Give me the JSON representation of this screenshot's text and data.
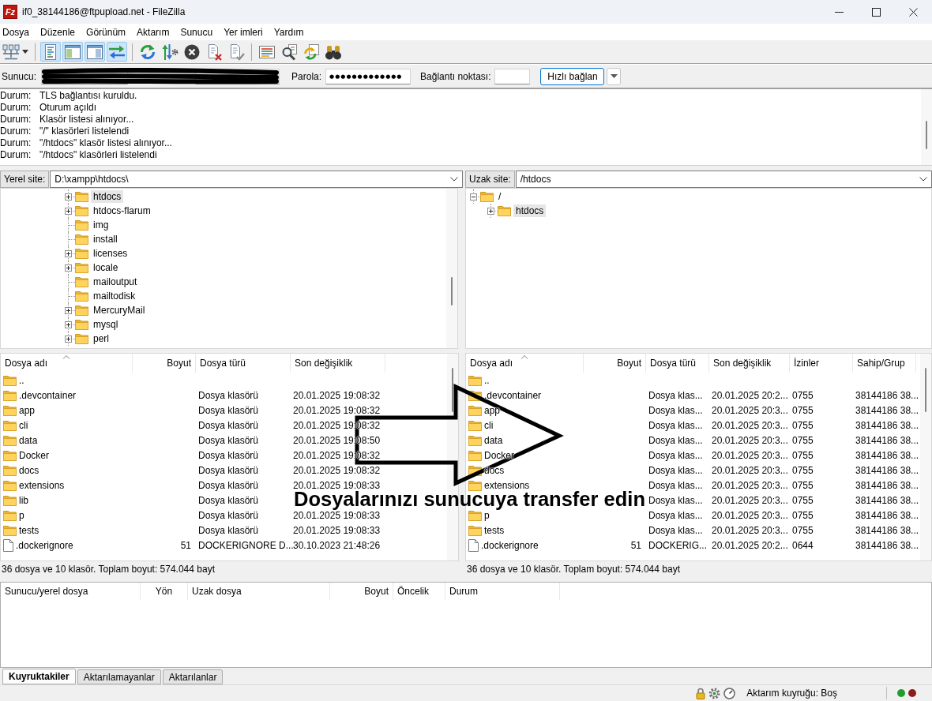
{
  "window": {
    "logo": "Fz",
    "title": "if0_38144186@ftpupload.net - FileZilla"
  },
  "menu": [
    "Dosya",
    "Düzenle",
    "Görünüm",
    "Aktarım",
    "Sunucu",
    "Yer imleri",
    "Yardım"
  ],
  "toolbar": {
    "groups": [
      [
        {
          "kind": "sitemanager"
        }
      ],
      [
        {
          "kind": "log",
          "on": true
        },
        {
          "kind": "localtree",
          "on": true
        },
        {
          "kind": "remotetree",
          "on": true
        },
        {
          "kind": "queue",
          "on": true
        }
      ],
      [
        {
          "kind": "refresh"
        },
        {
          "kind": "process"
        },
        {
          "kind": "cancel"
        },
        {
          "kind": "disconnect"
        },
        {
          "kind": "reconnect"
        }
      ],
      [
        {
          "kind": "filter"
        },
        {
          "kind": "compare"
        },
        {
          "kind": "sync"
        },
        {
          "kind": "search"
        }
      ]
    ]
  },
  "quickconnect": {
    "host_label": "Sunucu:",
    "password_label": "Parola:",
    "password": "●●●●●●●●●●●●●",
    "port_label": "Bağlantı noktası:",
    "connect_button": "Hızlı bağlan"
  },
  "message_log": [
    {
      "label": "Durum:",
      "text": "TLS bağlantısı kuruldu."
    },
    {
      "label": "Durum:",
      "text": "Oturum açıldı"
    },
    {
      "label": "Durum:",
      "text": "Klasör listesi alınıyor..."
    },
    {
      "label": "Durum:",
      "text": "\"/\" klasörleri listelendi"
    },
    {
      "label": "Durum:",
      "text": "\"/htdocs\" klasör listesi alınıyor..."
    },
    {
      "label": "Durum:",
      "text": "\"/htdocs\" klasörleri listelendi"
    }
  ],
  "local": {
    "site_label": "Yerel site:",
    "path": "D:\\xampp\\htdocs\\",
    "tree": [
      {
        "name": "htdocs",
        "expandable": true,
        "expanded": false,
        "selected": true
      },
      {
        "name": "htdocs-flarum",
        "expandable": true,
        "expanded": false,
        "selected": false
      },
      {
        "name": "img",
        "expandable": false,
        "expanded": false,
        "selected": false
      },
      {
        "name": "install",
        "expandable": false,
        "expanded": false,
        "selected": false
      },
      {
        "name": "licenses",
        "expandable": true,
        "expanded": false,
        "selected": false
      },
      {
        "name": "locale",
        "expandable": true,
        "expanded": false,
        "selected": false
      },
      {
        "name": "mailoutput",
        "expandable": false,
        "expanded": false,
        "selected": false
      },
      {
        "name": "mailtodisk",
        "expandable": false,
        "expanded": false,
        "selected": false
      },
      {
        "name": "MercuryMail",
        "expandable": true,
        "expanded": false,
        "selected": false
      },
      {
        "name": "mysql",
        "expandable": true,
        "expanded": false,
        "selected": false
      },
      {
        "name": "perl",
        "expandable": true,
        "expanded": false,
        "selected": false
      }
    ],
    "columns": [
      {
        "label": "Dosya adı",
        "sorted": true
      },
      {
        "label": "Boyut",
        "sorted": false
      },
      {
        "label": "Dosya türü",
        "sorted": false
      },
      {
        "label": "Son değişiklik",
        "sorted": false
      }
    ],
    "rows": [
      {
        "kind": "folder",
        "name": ".."
      },
      {
        "kind": "folder",
        "name": ".devcontainer",
        "type": "Dosya klasörü",
        "modified": "20.01.2025 19:08:32"
      },
      {
        "kind": "folder",
        "name": "app",
        "type": "Dosya klasörü",
        "modified": "20.01.2025 19:08:32"
      },
      {
        "kind": "folder",
        "name": "cli",
        "type": "Dosya klasörü",
        "modified": "20.01.2025 19:08:32"
      },
      {
        "kind": "folder",
        "name": "data",
        "type": "Dosya klasörü",
        "modified": "20.01.2025 19:08:50"
      },
      {
        "kind": "folder",
        "name": "Docker",
        "type": "Dosya klasörü",
        "modified": "20.01.2025 19:08:32"
      },
      {
        "kind": "folder",
        "name": "docs",
        "type": "Dosya klasörü",
        "modified": "20.01.2025 19:08:32"
      },
      {
        "kind": "folder",
        "name": "extensions",
        "type": "Dosya klasörü",
        "modified": "20.01.2025 19:08:33"
      },
      {
        "kind": "folder",
        "name": "lib",
        "type": "Dosya klasörü"
      },
      {
        "kind": "folder",
        "name": "p",
        "type": "Dosya klasörü",
        "modified": "20.01.2025 19:08:33"
      },
      {
        "kind": "folder",
        "name": "tests",
        "type": "Dosya klasörü",
        "modified": "20.01.2025 19:08:33"
      },
      {
        "kind": "file",
        "name": ".dockerignore",
        "size": "51",
        "type": "DOCKERIGNORE D...",
        "modified": "30.10.2023 21:48:26"
      }
    ],
    "summary": "36 dosya ve 10 klasör. Toplam boyut: 574.044 bayt"
  },
  "remote": {
    "site_label": "Uzak site:",
    "path": "/htdocs",
    "tree": [
      {
        "name": "/",
        "expandable": true,
        "expanded": true,
        "selected": false,
        "children": [
          {
            "name": "htdocs",
            "expandable": true,
            "expanded": false,
            "selected": true
          }
        ]
      }
    ],
    "columns": [
      {
        "label": "Dosya adı",
        "sorted": true
      },
      {
        "label": "Boyut",
        "sorted": false
      },
      {
        "label": "Dosya türü",
        "sorted": false
      },
      {
        "label": "Son değişiklik",
        "sorted": false
      },
      {
        "label": "İzinler",
        "sorted": false
      },
      {
        "label": "Sahip/Grup",
        "sorted": false
      }
    ],
    "rows": [
      {
        "kind": "folder",
        "name": ".."
      },
      {
        "kind": "folder",
        "name": ".devcontainer",
        "type": "Dosya klas...",
        "modified": "20.01.2025 20:2...",
        "permissions": "0755",
        "owner": "38144186 38..."
      },
      {
        "kind": "folder",
        "name": "app",
        "type": "Dosya klas...",
        "modified": "20.01.2025 20:3...",
        "permissions": "0755",
        "owner": "38144186 38..."
      },
      {
        "kind": "folder",
        "name": "cli",
        "type": "Dosya klas...",
        "modified": "20.01.2025 20:3...",
        "permissions": "0755",
        "owner": "38144186 38..."
      },
      {
        "kind": "folder",
        "name": "data",
        "type": "Dosya klas...",
        "modified": "20.01.2025 20:3...",
        "permissions": "0755",
        "owner": "38144186 38..."
      },
      {
        "kind": "folder",
        "name": "Docker",
        "type": "Dosya klas...",
        "modified": "20.01.2025 20:3...",
        "permissions": "0755",
        "owner": "38144186 38..."
      },
      {
        "kind": "folder",
        "name": "docs",
        "type": "Dosya klas...",
        "modified": "20.01.2025 20:3...",
        "permissions": "0755",
        "owner": "38144186 38..."
      },
      {
        "kind": "folder",
        "name": "extensions",
        "type": "Dosya klas...",
        "modified": "20.01.2025 20:3...",
        "permissions": "0755",
        "owner": "38144186 38..."
      },
      {
        "type": "Dosya klas...",
        "modified": "20.01.2025 20:3...",
        "permissions": "0755",
        "owner": "38144186 38..."
      },
      {
        "kind": "folder",
        "name": "p",
        "type": "Dosya klas...",
        "modified": "20.01.2025 20:3...",
        "permissions": "0755",
        "owner": "38144186 38..."
      },
      {
        "kind": "folder",
        "name": "tests",
        "type": "Dosya klas...",
        "modified": "20.01.2025 20:3...",
        "permissions": "0755",
        "owner": "38144186 38..."
      },
      {
        "kind": "file",
        "name": ".dockerignore",
        "size": "51",
        "type": "DOCKERIG...",
        "modified": "20.01.2025 20:2...",
        "permissions": "0644",
        "owner": "38144186 38..."
      }
    ],
    "summary": "36 dosya ve 10 klasör. Toplam boyut: 574.044 bayt"
  },
  "queue": {
    "columns": [
      "Sunucu/yerel dosya",
      "Yön",
      "Uzak dosya",
      "Boyut",
      "Öncelik",
      "Durum"
    ],
    "tabs": [
      {
        "label": "Kuyruktakiler",
        "selected": true
      },
      {
        "label": "Aktarılamayanlar",
        "selected": false
      },
      {
        "label": "Aktarılanlar",
        "selected": false
      }
    ]
  },
  "statusbar": {
    "text": "Aktarım kuyruğu: Boş",
    "leds": [
      {
        "color": "#1f9e2c"
      },
      {
        "color": "#8c1d1d"
      }
    ]
  },
  "annotation": {
    "text": "Dosyalarınızı sunucuya transfer edin"
  }
}
